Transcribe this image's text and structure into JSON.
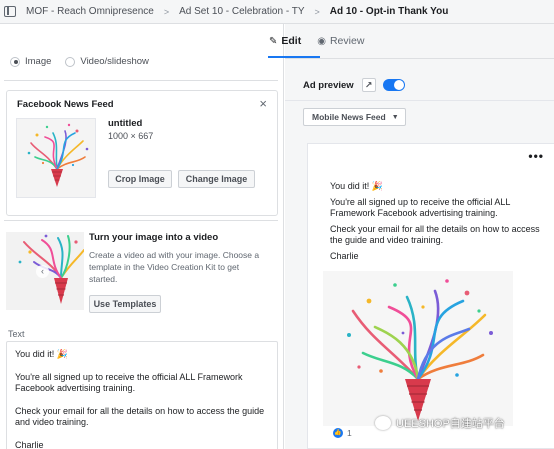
{
  "breadcrumb": {
    "campaign": "MOF - Reach Omnipresence",
    "ad_set": "Ad Set 10 - Celebration - TY",
    "ad": "Ad 10 - Opt-in Thank You"
  },
  "format": {
    "options": [
      {
        "label": "Image",
        "selected": true
      },
      {
        "label": "Video/slideshow",
        "selected": false
      }
    ]
  },
  "placement_card": {
    "title": "Facebook News Feed",
    "image_name": "untitled",
    "image_dims": "1000 × 667",
    "crop_label": "Crop Image",
    "change_label": "Change Image"
  },
  "video_card": {
    "title": "Turn your image into a video",
    "description": "Create a video ad with your image. Choose a template in the Video Creation Kit to get started.",
    "button_label": "Use Templates"
  },
  "text_field": {
    "label": "Text",
    "lines": [
      "You did it! 🎉",
      "You're all signed up to receive the official ALL Framework Facebook advertising training.",
      "Check your email for all the details on how to access the guide and video training.",
      "Charlie"
    ]
  },
  "tabs": {
    "edit": "Edit",
    "review": "Review"
  },
  "preview": {
    "label": "Ad preview",
    "placement": "Mobile News Feed",
    "toggle_on": true,
    "more": "•••",
    "lines": [
      "You did it! 🎉",
      "You're all signed up to receive the official ALL Framework Facebook advertising training.",
      "Check your email for all the details on how to access the guide and video training.",
      "Charlie"
    ],
    "reaction_count": "1"
  },
  "watermark": "UEESHOP自建站平台",
  "colors": {
    "accent": "#1877f2",
    "border": "#dddfe2",
    "panel_bg": "#f5f6f7"
  }
}
